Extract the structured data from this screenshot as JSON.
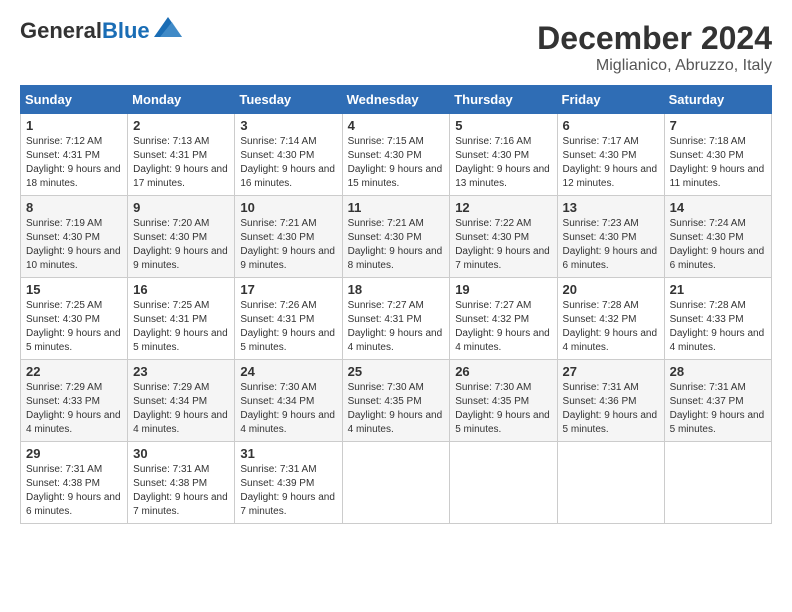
{
  "logo": {
    "general": "General",
    "blue": "Blue"
  },
  "title": "December 2024",
  "location": "Miglianico, Abruzzo, Italy",
  "days_of_week": [
    "Sunday",
    "Monday",
    "Tuesday",
    "Wednesday",
    "Thursday",
    "Friday",
    "Saturday"
  ],
  "weeks": [
    [
      {
        "day": "1",
        "sunrise": "7:12 AM",
        "sunset": "4:31 PM",
        "daylight": "9 hours and 18 minutes."
      },
      {
        "day": "2",
        "sunrise": "7:13 AM",
        "sunset": "4:31 PM",
        "daylight": "9 hours and 17 minutes."
      },
      {
        "day": "3",
        "sunrise": "7:14 AM",
        "sunset": "4:30 PM",
        "daylight": "9 hours and 16 minutes."
      },
      {
        "day": "4",
        "sunrise": "7:15 AM",
        "sunset": "4:30 PM",
        "daylight": "9 hours and 15 minutes."
      },
      {
        "day": "5",
        "sunrise": "7:16 AM",
        "sunset": "4:30 PM",
        "daylight": "9 hours and 13 minutes."
      },
      {
        "day": "6",
        "sunrise": "7:17 AM",
        "sunset": "4:30 PM",
        "daylight": "9 hours and 12 minutes."
      },
      {
        "day": "7",
        "sunrise": "7:18 AM",
        "sunset": "4:30 PM",
        "daylight": "9 hours and 11 minutes."
      }
    ],
    [
      {
        "day": "8",
        "sunrise": "7:19 AM",
        "sunset": "4:30 PM",
        "daylight": "9 hours and 10 minutes."
      },
      {
        "day": "9",
        "sunrise": "7:20 AM",
        "sunset": "4:30 PM",
        "daylight": "9 hours and 9 minutes."
      },
      {
        "day": "10",
        "sunrise": "7:21 AM",
        "sunset": "4:30 PM",
        "daylight": "9 hours and 9 minutes."
      },
      {
        "day": "11",
        "sunrise": "7:21 AM",
        "sunset": "4:30 PM",
        "daylight": "9 hours and 8 minutes."
      },
      {
        "day": "12",
        "sunrise": "7:22 AM",
        "sunset": "4:30 PM",
        "daylight": "9 hours and 7 minutes."
      },
      {
        "day": "13",
        "sunrise": "7:23 AM",
        "sunset": "4:30 PM",
        "daylight": "9 hours and 6 minutes."
      },
      {
        "day": "14",
        "sunrise": "7:24 AM",
        "sunset": "4:30 PM",
        "daylight": "9 hours and 6 minutes."
      }
    ],
    [
      {
        "day": "15",
        "sunrise": "7:25 AM",
        "sunset": "4:30 PM",
        "daylight": "9 hours and 5 minutes."
      },
      {
        "day": "16",
        "sunrise": "7:25 AM",
        "sunset": "4:31 PM",
        "daylight": "9 hours and 5 minutes."
      },
      {
        "day": "17",
        "sunrise": "7:26 AM",
        "sunset": "4:31 PM",
        "daylight": "9 hours and 5 minutes."
      },
      {
        "day": "18",
        "sunrise": "7:27 AM",
        "sunset": "4:31 PM",
        "daylight": "9 hours and 4 minutes."
      },
      {
        "day": "19",
        "sunrise": "7:27 AM",
        "sunset": "4:32 PM",
        "daylight": "9 hours and 4 minutes."
      },
      {
        "day": "20",
        "sunrise": "7:28 AM",
        "sunset": "4:32 PM",
        "daylight": "9 hours and 4 minutes."
      },
      {
        "day": "21",
        "sunrise": "7:28 AM",
        "sunset": "4:33 PM",
        "daylight": "9 hours and 4 minutes."
      }
    ],
    [
      {
        "day": "22",
        "sunrise": "7:29 AM",
        "sunset": "4:33 PM",
        "daylight": "9 hours and 4 minutes."
      },
      {
        "day": "23",
        "sunrise": "7:29 AM",
        "sunset": "4:34 PM",
        "daylight": "9 hours and 4 minutes."
      },
      {
        "day": "24",
        "sunrise": "7:30 AM",
        "sunset": "4:34 PM",
        "daylight": "9 hours and 4 minutes."
      },
      {
        "day": "25",
        "sunrise": "7:30 AM",
        "sunset": "4:35 PM",
        "daylight": "9 hours and 4 minutes."
      },
      {
        "day": "26",
        "sunrise": "7:30 AM",
        "sunset": "4:35 PM",
        "daylight": "9 hours and 5 minutes."
      },
      {
        "day": "27",
        "sunrise": "7:31 AM",
        "sunset": "4:36 PM",
        "daylight": "9 hours and 5 minutes."
      },
      {
        "day": "28",
        "sunrise": "7:31 AM",
        "sunset": "4:37 PM",
        "daylight": "9 hours and 5 minutes."
      }
    ],
    [
      {
        "day": "29",
        "sunrise": "7:31 AM",
        "sunset": "4:38 PM",
        "daylight": "9 hours and 6 minutes."
      },
      {
        "day": "30",
        "sunrise": "7:31 AM",
        "sunset": "4:38 PM",
        "daylight": "9 hours and 7 minutes."
      },
      {
        "day": "31",
        "sunrise": "7:31 AM",
        "sunset": "4:39 PM",
        "daylight": "9 hours and 7 minutes."
      },
      null,
      null,
      null,
      null
    ]
  ],
  "labels": {
    "sunrise": "Sunrise:",
    "sunset": "Sunset:",
    "daylight": "Daylight:"
  }
}
